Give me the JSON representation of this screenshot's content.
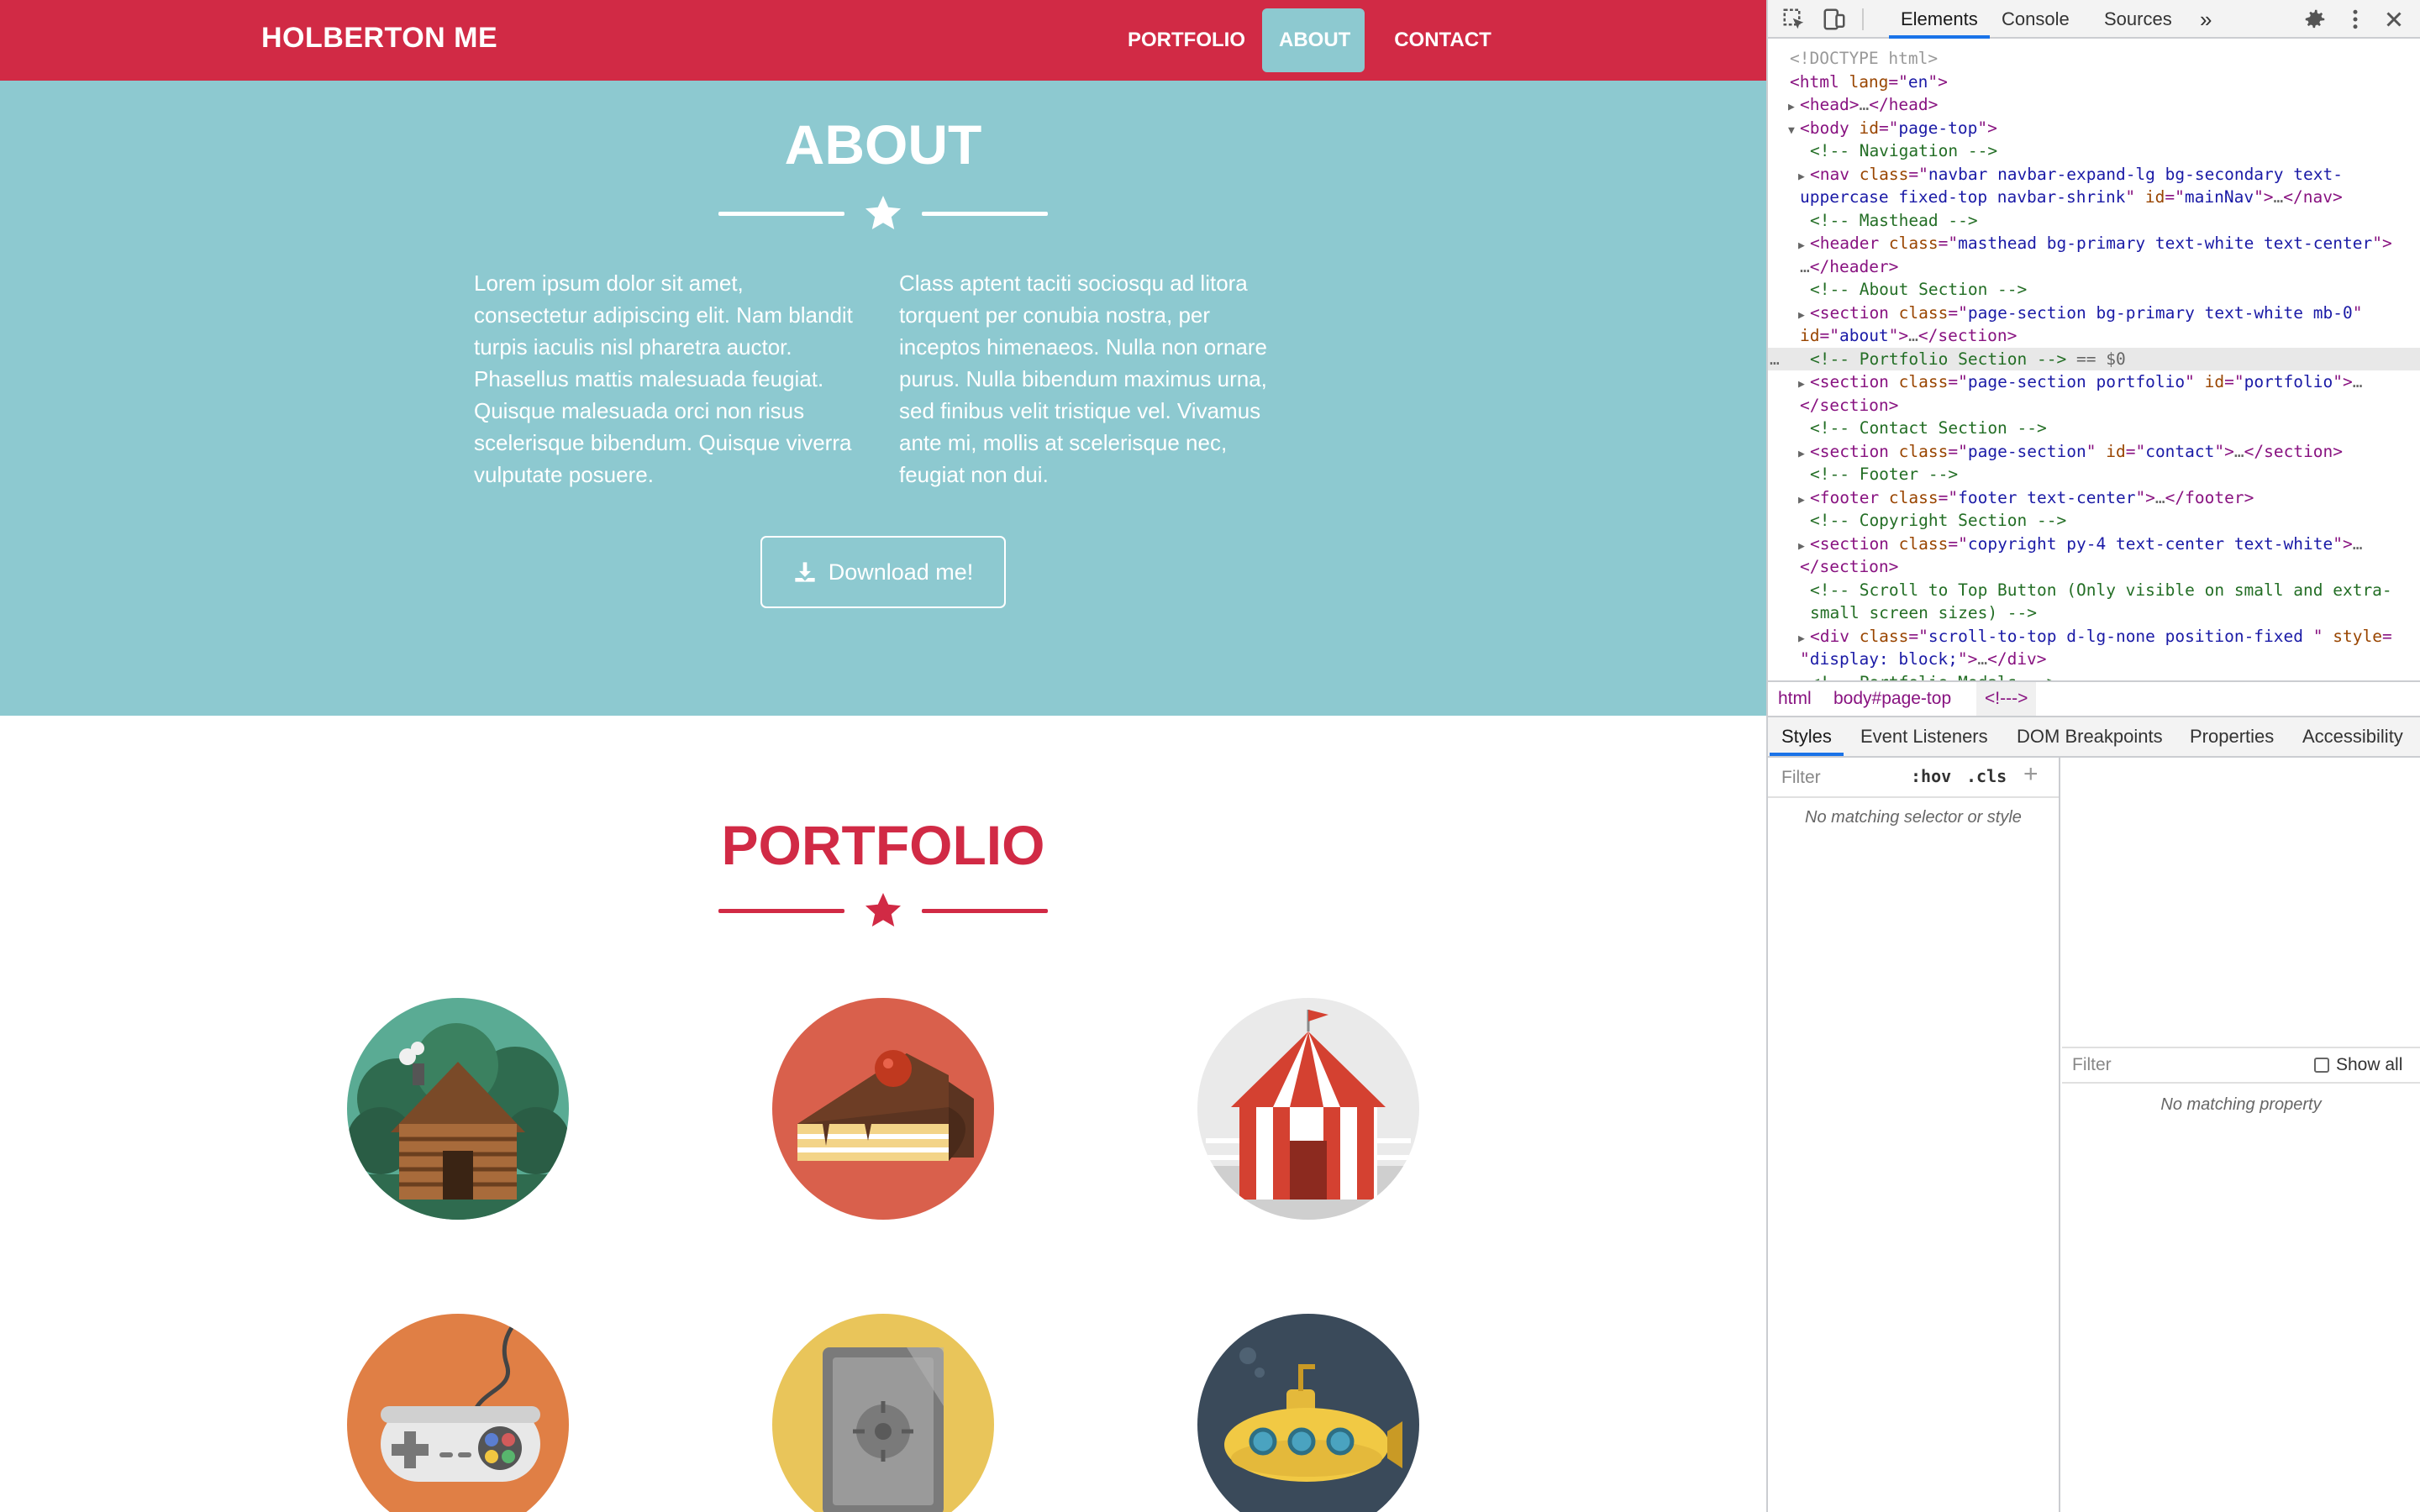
{
  "navbar": {
    "brand": "HOLBERTON ME",
    "links": [
      "PORTFOLIO",
      "ABOUT",
      "CONTACT"
    ],
    "active": "ABOUT"
  },
  "about": {
    "title": "ABOUT",
    "col1": "Lorem ipsum dolor sit amet, consectetur adipiscing elit. Nam blandit turpis iaculis nisl pharetra auctor. Phasellus mattis malesuada feugiat. Quisque malesuada orci non risus scelerisque bibendum. Quisque viverra vulputate posuere.",
    "col2": "Class aptent taciti sociosqu ad litora torquent per conubia nostra, per inceptos himenaeos. Nulla non ornare purus. Nulla bibendum maximus urna, sed finibus velit tristique vel. Vivamus ante mi, mollis at scelerisque nec, feugiat non dui.",
    "download_label": "Download me!"
  },
  "portfolio": {
    "title": "PORTFOLIO",
    "items": [
      {
        "name": "cabin",
        "bg": "#ae5263",
        "circle": "#5aab94"
      },
      {
        "name": "cake",
        "bg": "#50a4b5",
        "circle": "#d9604c"
      },
      {
        "name": "circus",
        "bg": "#111111",
        "circle": "#eaeaea"
      },
      {
        "name": "game",
        "bg": "#3b80bd",
        "circle": "#e07f45"
      },
      {
        "name": "safe",
        "bg": "#1a37ad",
        "circle": "#e9c55a"
      },
      {
        "name": "submarine",
        "bg": "#c9b0a2",
        "circle": "#3a4a5a"
      }
    ]
  },
  "devtools": {
    "tabs": [
      "Elements",
      "Console",
      "Sources",
      "»"
    ],
    "active_tab": "Elements",
    "dom_lines": [
      {
        "indent": 0,
        "tri": "",
        "parts": [
          [
            "doctype",
            "<!DOCTYPE html>"
          ]
        ]
      },
      {
        "indent": 0,
        "tri": "",
        "parts": [
          [
            "tag",
            "<html "
          ],
          [
            "attr",
            "lang"
          ],
          [
            "tag",
            "=\""
          ],
          [
            "val",
            "en"
          ],
          [
            "tag",
            "\">"
          ]
        ]
      },
      {
        "indent": 1,
        "tri": "▶",
        "parts": [
          [
            "tag",
            "<head>"
          ],
          [
            "dim",
            "…"
          ],
          [
            "tag",
            "</head>"
          ]
        ]
      },
      {
        "indent": 1,
        "tri": "▼",
        "parts": [
          [
            "tag",
            "<body "
          ],
          [
            "attr",
            "id"
          ],
          [
            "tag",
            "=\""
          ],
          [
            "val",
            "page-top"
          ],
          [
            "tag",
            "\">"
          ]
        ]
      },
      {
        "indent": 2,
        "tri": "",
        "parts": [
          [
            "comment",
            "<!-- Navigation -->"
          ]
        ]
      },
      {
        "indent": 2,
        "tri": "▶",
        "parts": [
          [
            "tag",
            "<nav "
          ],
          [
            "attr",
            "class"
          ],
          [
            "tag",
            "=\""
          ],
          [
            "val",
            "navbar navbar-expand-lg bg-secondary text-"
          ]
        ]
      },
      {
        "indent": 1,
        "tri": "",
        "parts": [
          [
            "val",
            "uppercase fixed-top navbar-shrink"
          ],
          [
            "tag",
            "\" "
          ],
          [
            "attr",
            "id"
          ],
          [
            "tag",
            "=\""
          ],
          [
            "val",
            "mainNav"
          ],
          [
            "tag",
            "\">"
          ],
          [
            "dim",
            "…"
          ],
          [
            "tag",
            "</nav>"
          ]
        ]
      },
      {
        "indent": 2,
        "tri": "",
        "parts": [
          [
            "comment",
            "<!-- Masthead -->"
          ]
        ]
      },
      {
        "indent": 2,
        "tri": "▶",
        "parts": [
          [
            "tag",
            "<header "
          ],
          [
            "attr",
            "class"
          ],
          [
            "tag",
            "=\""
          ],
          [
            "val",
            "masthead bg-primary text-white text-center"
          ],
          [
            "tag",
            "\">"
          ]
        ]
      },
      {
        "indent": 1,
        "tri": "",
        "parts": [
          [
            "dim",
            "…"
          ],
          [
            "tag",
            "</header>"
          ]
        ]
      },
      {
        "indent": 2,
        "tri": "",
        "parts": [
          [
            "comment",
            "<!-- About Section -->"
          ]
        ]
      },
      {
        "indent": 2,
        "tri": "▶",
        "parts": [
          [
            "tag",
            "<section "
          ],
          [
            "attr",
            "class"
          ],
          [
            "tag",
            "=\""
          ],
          [
            "val",
            "page-section bg-primary text-white mb-0"
          ],
          [
            "tag",
            "\""
          ]
        ]
      },
      {
        "indent": 1,
        "tri": "",
        "parts": [
          [
            "attr",
            "id"
          ],
          [
            "tag",
            "=\""
          ],
          [
            "val",
            "about"
          ],
          [
            "tag",
            "\">"
          ],
          [
            "dim",
            "…"
          ],
          [
            "tag",
            "</section>"
          ]
        ]
      },
      {
        "indent": 2,
        "tri": "",
        "selected": true,
        "parts": [
          [
            "comment",
            "<!-- Portfolio Section -->"
          ],
          [
            "dim",
            " == $0"
          ]
        ]
      },
      {
        "indent": 2,
        "tri": "▶",
        "parts": [
          [
            "tag",
            "<section "
          ],
          [
            "attr",
            "class"
          ],
          [
            "tag",
            "=\""
          ],
          [
            "val",
            "page-section portfolio"
          ],
          [
            "tag",
            "\" "
          ],
          [
            "attr",
            "id"
          ],
          [
            "tag",
            "=\""
          ],
          [
            "val",
            "portfolio"
          ],
          [
            "tag",
            "\">"
          ],
          [
            "dim",
            "…"
          ]
        ]
      },
      {
        "indent": 1,
        "tri": "",
        "parts": [
          [
            "tag",
            "</section>"
          ]
        ]
      },
      {
        "indent": 2,
        "tri": "",
        "parts": [
          [
            "comment",
            "<!-- Contact Section -->"
          ]
        ]
      },
      {
        "indent": 2,
        "tri": "▶",
        "parts": [
          [
            "tag",
            "<section "
          ],
          [
            "attr",
            "class"
          ],
          [
            "tag",
            "=\""
          ],
          [
            "val",
            "page-section"
          ],
          [
            "tag",
            "\" "
          ],
          [
            "attr",
            "id"
          ],
          [
            "tag",
            "=\""
          ],
          [
            "val",
            "contact"
          ],
          [
            "tag",
            "\">"
          ],
          [
            "dim",
            "…"
          ],
          [
            "tag",
            "</section>"
          ]
        ]
      },
      {
        "indent": 2,
        "tri": "",
        "parts": [
          [
            "comment",
            "<!-- Footer -->"
          ]
        ]
      },
      {
        "indent": 2,
        "tri": "▶",
        "parts": [
          [
            "tag",
            "<footer "
          ],
          [
            "attr",
            "class"
          ],
          [
            "tag",
            "=\""
          ],
          [
            "val",
            "footer text-center"
          ],
          [
            "tag",
            "\">"
          ],
          [
            "dim",
            "…"
          ],
          [
            "tag",
            "</footer>"
          ]
        ]
      },
      {
        "indent": 2,
        "tri": "",
        "parts": [
          [
            "comment",
            "<!-- Copyright Section -->"
          ]
        ]
      },
      {
        "indent": 2,
        "tri": "▶",
        "parts": [
          [
            "tag",
            "<section "
          ],
          [
            "attr",
            "class"
          ],
          [
            "tag",
            "=\""
          ],
          [
            "val",
            "copyright py-4 text-center text-white"
          ],
          [
            "tag",
            "\">"
          ],
          [
            "dim",
            "…"
          ]
        ]
      },
      {
        "indent": 1,
        "tri": "",
        "parts": [
          [
            "tag",
            "</section>"
          ]
        ]
      },
      {
        "indent": 2,
        "tri": "",
        "parts": [
          [
            "comment",
            "<!-- Scroll to Top Button (Only visible on small and extra-"
          ]
        ]
      },
      {
        "indent": 2,
        "tri": "",
        "parts": [
          [
            "comment",
            "small screen sizes) -->"
          ]
        ]
      },
      {
        "indent": 2,
        "tri": "▶",
        "parts": [
          [
            "tag",
            "<div "
          ],
          [
            "attr",
            "class"
          ],
          [
            "tag",
            "=\""
          ],
          [
            "val",
            "scroll-to-top d-lg-none position-fixed "
          ],
          [
            "tag",
            "\" "
          ],
          [
            "attr",
            "style"
          ],
          [
            "tag",
            "="
          ]
        ]
      },
      {
        "indent": 1,
        "tri": "",
        "parts": [
          [
            "tag",
            "\""
          ],
          [
            "val",
            "display: block;"
          ],
          [
            "tag",
            "\">"
          ],
          [
            "dim",
            "…"
          ],
          [
            "tag",
            "</div>"
          ]
        ]
      },
      {
        "indent": 2,
        "tri": "",
        "parts": [
          [
            "comment",
            "<!-- Portfolio Modals -->"
          ]
        ]
      }
    ],
    "breadcrumbs": [
      "html",
      "body#page-top",
      "<!--->"
    ],
    "lower_tabs": [
      "Styles",
      "Event Listeners",
      "DOM Breakpoints",
      "Properties",
      "Accessibility"
    ],
    "active_lower_tab": "Styles",
    "styles_filter_placeholder": "Filter",
    "hov": ":hov",
    "cls": ".cls",
    "styles_empty": "No matching selector or style",
    "computed_filter_placeholder": "Filter",
    "show_all": "Show all",
    "computed_empty": "No matching property"
  }
}
